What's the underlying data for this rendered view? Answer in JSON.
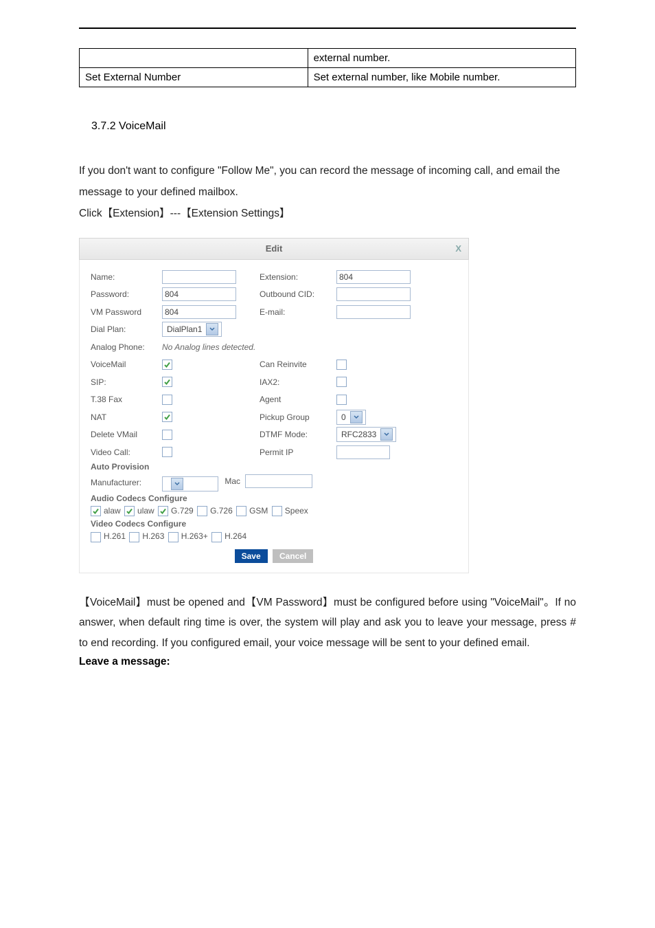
{
  "outer_table": {
    "row1_col2": "external number.",
    "row2_col1": "Set External Number",
    "row2_col2": "Set external number, like Mobile number."
  },
  "section_heading": "3.7.2 VoiceMail",
  "intro_para": "If you don't want to configure \"Follow Me\", you can record the message of incoming call, and email the message to your defined mailbox.",
  "click_line": "Click【Extension】---【Extension Settings】",
  "edit": {
    "title": "Edit",
    "close": "X",
    "labels": {
      "name": "Name:",
      "extension": "Extension:",
      "password": "Password:",
      "outbound_cid": "Outbound CID:",
      "vm_password": "VM Password",
      "email": "E-mail:",
      "dial_plan": "Dial Plan:",
      "analog_phone": "Analog Phone:",
      "voicemail": "VoiceMail",
      "can_reinvite": "Can Reinvite",
      "sip": "SIP:",
      "iax2": "IAX2:",
      "t38fax": "T.38 Fax",
      "agent": "Agent",
      "nat": "NAT",
      "pickup_group": "Pickup Group",
      "delete_vmail": "Delete VMail",
      "dtmf_mode": "DTMF Mode:",
      "video_call": "Video Call:",
      "permit_ip": "Permit IP",
      "auto_provision": "Auto Provision",
      "manufacturer": "Manufacturer:",
      "mac": "Mac",
      "audio_codecs": "Audio Codecs Configure",
      "video_codecs": "Video Codecs Configure"
    },
    "values": {
      "name": "",
      "extension": "804",
      "password": "804",
      "outbound_cid": "",
      "vm_password": "804",
      "email": "",
      "dial_plan": "DialPlan1",
      "analog_detected": "No Analog lines detected.",
      "pickup_group": "0",
      "dtmf_mode": "RFC2833",
      "permit_ip": "",
      "manufacturer": "",
      "mac": ""
    },
    "checks": {
      "voicemail": true,
      "can_reinvite": false,
      "sip": true,
      "iax2": false,
      "t38fax": false,
      "agent": false,
      "nat": true,
      "delete_vmail": false,
      "video_call": false
    },
    "audio_codecs": [
      {
        "label": "alaw",
        "checked": true
      },
      {
        "label": "ulaw",
        "checked": true
      },
      {
        "label": "G.729",
        "checked": true
      },
      {
        "label": "G.726",
        "checked": false
      },
      {
        "label": "GSM",
        "checked": false
      },
      {
        "label": "Speex",
        "checked": false
      }
    ],
    "video_codecs": [
      {
        "label": "H.261",
        "checked": false
      },
      {
        "label": "H.263",
        "checked": false
      },
      {
        "label": "H.263+",
        "checked": false
      },
      {
        "label": "H.264",
        "checked": false
      }
    ],
    "buttons": {
      "save": "Save",
      "cancel": "Cancel"
    }
  },
  "post_para": "【VoiceMail】must be opened and【VM Password】must be configured before using \"VoiceMail\"。If no answer, when default ring time is over, the system will play and ask you to leave your message, press # to end recording. If you configured email, your voice message will be sent to your defined email.",
  "leave_message": "Leave a message:"
}
